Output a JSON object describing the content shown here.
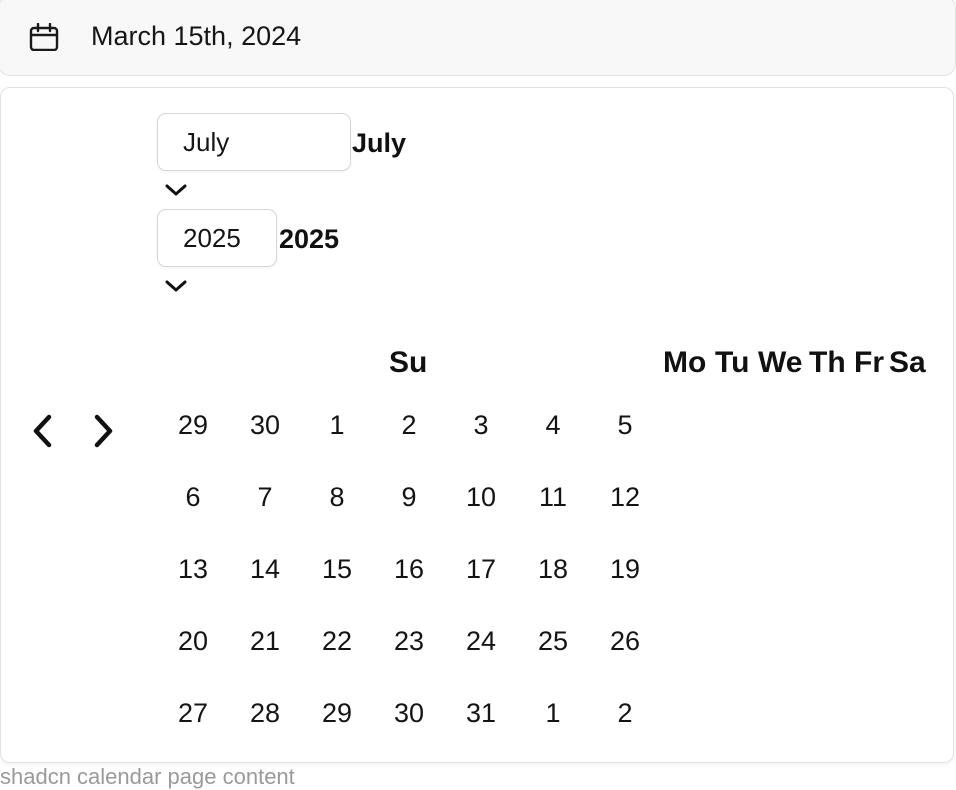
{
  "trigger": {
    "date_text": "March 15th, 2024",
    "icon": "calendar-icon"
  },
  "background_text": "shadcn calendar page content",
  "popover": {
    "month_select": {
      "value": "July",
      "label": "July"
    },
    "year_select": {
      "value": "2025",
      "label": "2025"
    },
    "nav": {
      "prev_icon": "chevron-left-icon",
      "next_icon": "chevron-right-icon"
    },
    "weekdays": [
      "Su",
      "Mo",
      "Tu",
      "We",
      "Th",
      "Fr",
      "Sa"
    ],
    "weeks": [
      [
        "29",
        "30",
        "1",
        "2",
        "3",
        "4",
        "5"
      ],
      [
        "6",
        "7",
        "8",
        "9",
        "10",
        "11",
        "12"
      ],
      [
        "13",
        "14",
        "15",
        "16",
        "17",
        "18",
        "19"
      ],
      [
        "20",
        "21",
        "22",
        "23",
        "24",
        "25",
        "26"
      ],
      [
        "27",
        "28",
        "29",
        "30",
        "31",
        "1",
        "2"
      ]
    ]
  }
}
